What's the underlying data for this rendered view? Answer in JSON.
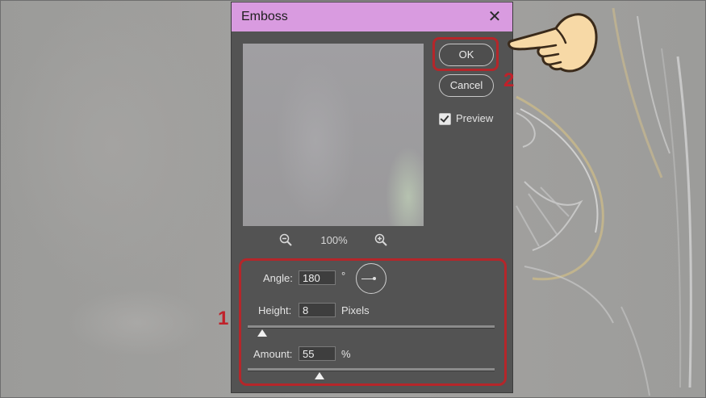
{
  "dialog": {
    "title": "Emboss",
    "close_glyph": "✕",
    "buttons": {
      "ok": "OK",
      "cancel": "Cancel"
    },
    "preview_checkbox": {
      "label": "Preview",
      "checked": true
    },
    "zoom": {
      "level": "100%"
    },
    "params": {
      "angle": {
        "label": "Angle:",
        "value": "180",
        "unit": "°"
      },
      "height": {
        "label": "Height:",
        "value": "8",
        "unit": "Pixels",
        "slider_fraction": 0.06
      },
      "amount": {
        "label": "Amount:",
        "value": "55",
        "unit": "%",
        "slider_fraction": 0.29
      }
    }
  },
  "annotations": {
    "step1": "1",
    "step2": "2"
  },
  "colors": {
    "titlebar": "#d99be0",
    "dialog_bg": "#535353",
    "highlight": "#b5262a"
  }
}
